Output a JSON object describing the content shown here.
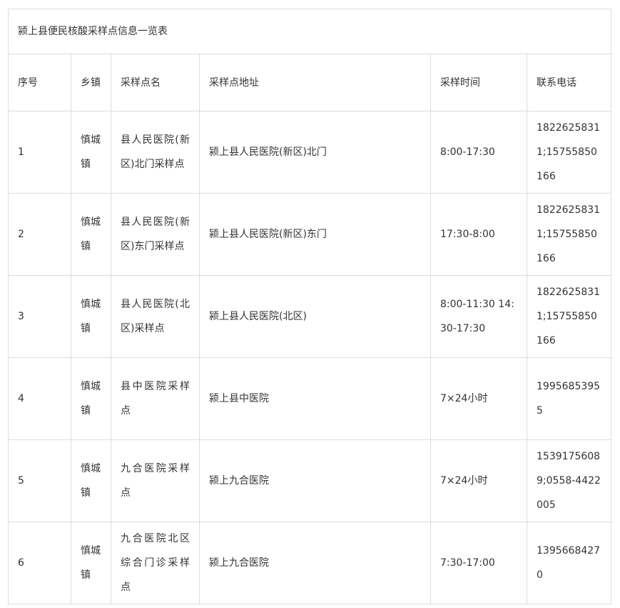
{
  "table": {
    "title": "颍上县便民核酸采样点信息一览表",
    "headers": {
      "no": "序号",
      "town": "乡镇",
      "site_name": "采样点名",
      "address": "采样点地址",
      "hours": "采样时间",
      "phone": "联系电话"
    },
    "rows": [
      {
        "no": "1",
        "town": "慎城镇",
        "site_name": "县人民医院(新区)北门采样点",
        "address": "颍上县人民医院(新区)北门",
        "hours": "8:00-17:30",
        "phone": "18226258311;15755850166"
      },
      {
        "no": "2",
        "town": "慎城镇",
        "site_name": "县人民医院(新区)东门采样点",
        "address": "颍上县人民医院(新区)东门",
        "hours": "17:30-8:00",
        "phone": "18226258311;15755850166"
      },
      {
        "no": "3",
        "town": "慎城镇",
        "site_name": "县人民医院(北区)采样点",
        "address": "颍上县人民医院(北区)",
        "hours": "8:00-11:30 14:30-17:30",
        "phone": "18226258311;15755850166"
      },
      {
        "no": "4",
        "town": "慎城镇",
        "site_name": "县中医院采样点",
        "address": "颍上县中医院",
        "hours": "7×24小时",
        "phone": "19956853955"
      },
      {
        "no": "5",
        "town": "慎城镇",
        "site_name": "九合医院采样点",
        "address": "颍上九合医院",
        "hours": "7×24小时",
        "phone": "15391756089;0558-4422005"
      },
      {
        "no": "6",
        "town": "慎城镇",
        "site_name": "九合医院北区综合门诊采样点",
        "address": "颍上九合医院",
        "hours": "7:30-17:00",
        "phone": "13956684270"
      }
    ]
  }
}
